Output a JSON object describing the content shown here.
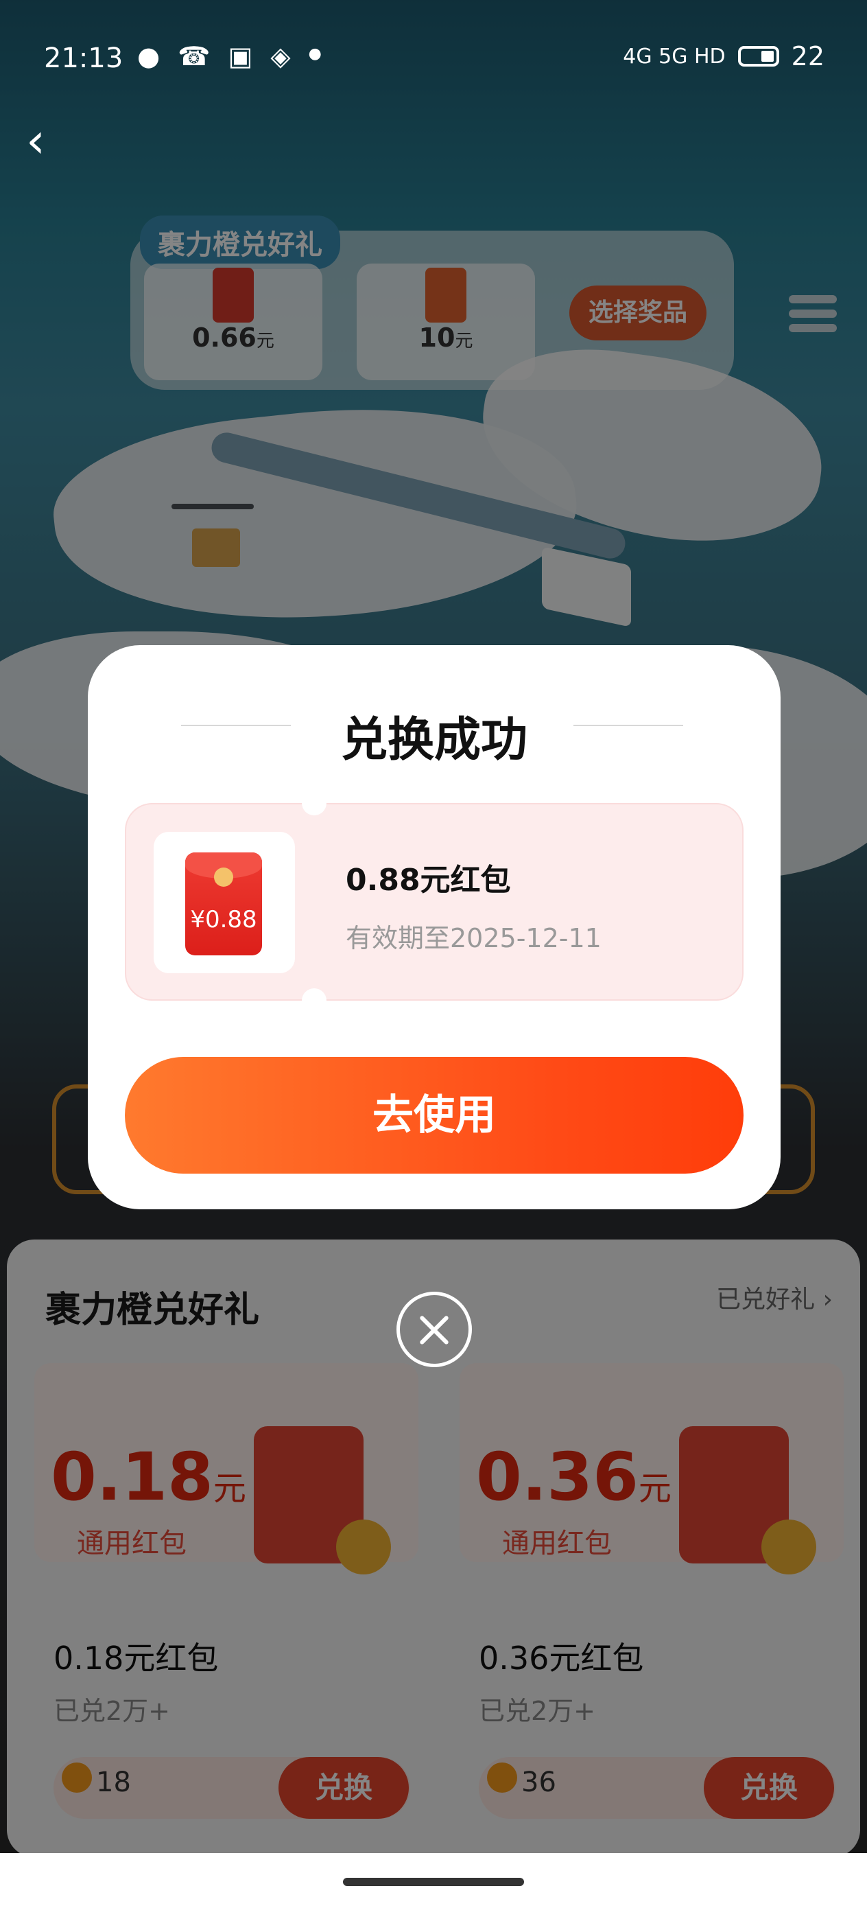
{
  "status_bar": {
    "time": "21:13",
    "network": "4G 5G HD",
    "battery": "22",
    "notification_icons": [
      "wechat-icon",
      "missed-call-icon",
      "image-icon",
      "layers-icon",
      "dot-icon"
    ]
  },
  "top_card": {
    "tag": "裹力橙兑好礼",
    "items": [
      {
        "amount": "0.66",
        "unit": "元"
      },
      {
        "amount": "10",
        "unit": "元"
      }
    ],
    "choose_label": "选择奖品"
  },
  "modal": {
    "title": "兑换成功",
    "prize": {
      "badge_value": "¥0.88",
      "name": "0.88元红包",
      "expiry": "有效期至2025-12-11"
    },
    "use_button": "去使用"
  },
  "list_panel": {
    "title": "裹力橙兑好礼",
    "link": "已兑好礼 ›",
    "products": [
      {
        "price": "0.18",
        "unit": "元",
        "kind": "通用红包",
        "name": "0.18元红包",
        "sold": "已兑2万+",
        "cost": "18",
        "action": "兑换"
      },
      {
        "price": "0.36",
        "unit": "元",
        "kind": "通用红包",
        "name": "0.36元红包",
        "sold": "已兑2万+",
        "cost": "36",
        "action": "兑换"
      }
    ]
  },
  "colors": {
    "accent": "#ff4a16",
    "accent_start": "#ff7a2e",
    "ticket_bg": "#fdecec",
    "red_packet": "#e62a22"
  }
}
